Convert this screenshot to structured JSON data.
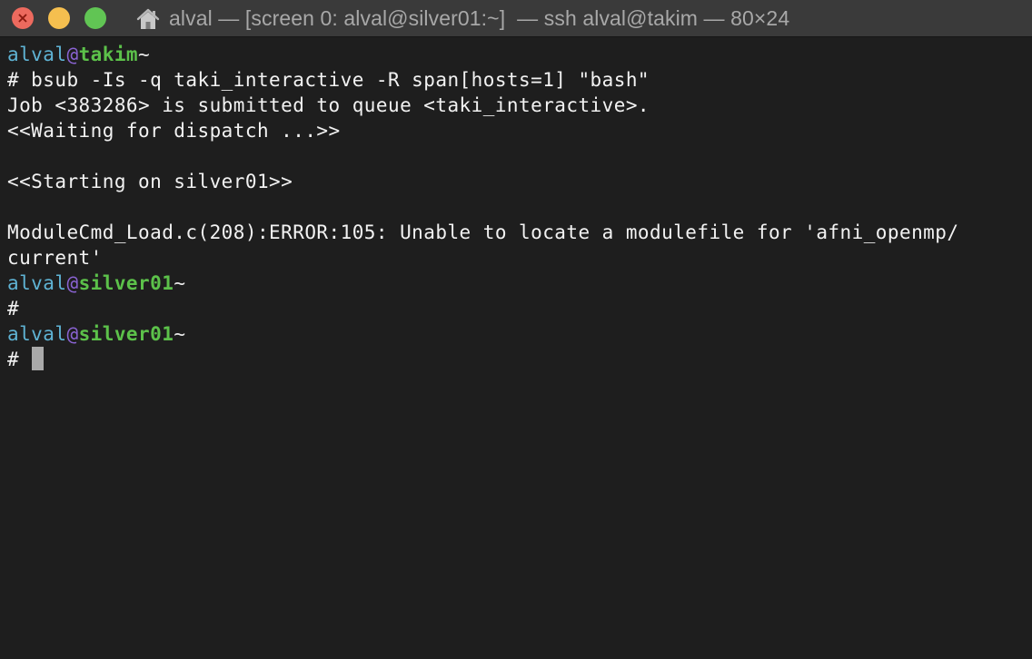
{
  "window": {
    "title": "alval — [screen 0: alval@silver01:~]  — ssh alval@takim — 80×24",
    "controls": {
      "close_glyph": "×",
      "close_color": "#ed6a5e",
      "minimize_color": "#f5bf4f",
      "zoom_color": "#61c554"
    },
    "title_icon": "home-icon"
  },
  "terminal": {
    "colors": {
      "background": "#1e1e1e",
      "text": "#f2f2f2",
      "user": "#5fb3d4",
      "at": "#8a63d2",
      "host": "#5cc14a"
    },
    "prompt1": {
      "user": "alval",
      "at": "@",
      "host": "takim",
      "tilde": "~"
    },
    "command1": "# bsub -Is -q taki_interactive -R span[hosts=1] \"bash\"",
    "output": [
      "Job <383286> is submitted to queue <taki_interactive>.",
      "<<Waiting for dispatch ...>>",
      "",
      "<<Starting on silver01>>",
      "",
      "ModuleCmd_Load.c(208):ERROR:105: Unable to locate a modulefile for 'afni_openmp/",
      "current'"
    ],
    "prompt2": {
      "user": "alval",
      "at": "@",
      "host": "silver01",
      "tilde": "~"
    },
    "command2": "#",
    "prompt3": {
      "user": "alval",
      "at": "@",
      "host": "silver01",
      "tilde": "~"
    },
    "command3": "# "
  }
}
